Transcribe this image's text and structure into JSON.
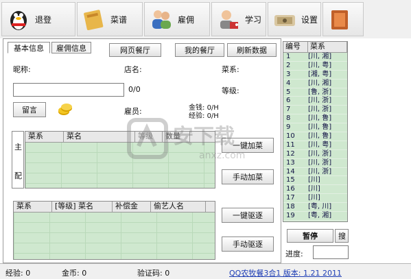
{
  "toolbar": {
    "buttons": [
      {
        "label": "退登",
        "icon": "penguin-icon"
      },
      {
        "label": "菜谱",
        "icon": "recipe-book-icon"
      },
      {
        "label": "雇佣",
        "icon": "people-icon"
      },
      {
        "label": "学习",
        "icon": "learning-icon"
      },
      {
        "label": "设置",
        "icon": "settings-icon"
      },
      {
        "label": "",
        "icon": "book-icon"
      }
    ]
  },
  "tabs": {
    "basic": "基本信息",
    "hire": "雇佣信息"
  },
  "nav_buttons": {
    "web_restaurant": "网页餐厅",
    "my_restaurant": "我的餐厅",
    "refresh": "刷新数据"
  },
  "profile": {
    "nickname_label": "昵称:",
    "nickname_value": "",
    "char_count": "0/0",
    "shop_label": "店名:",
    "cuisine_label": "菜系:",
    "level_label": "等级:",
    "employee_label": "雇员:",
    "money_label": "金钱:",
    "money_value": "0/H",
    "exp_label": "经验:",
    "exp_value": "0/H",
    "message_button": "留言",
    "coin_icon": "coins-icon"
  },
  "dish_grid": {
    "side_labels": [
      "主",
      "配"
    ],
    "columns": [
      "菜系",
      "菜名",
      "等级",
      "数量"
    ]
  },
  "helper_grid": {
    "columns": [
      "菜系",
      "[等级] 菜名",
      "补偿金",
      "偷艺人名"
    ]
  },
  "action_buttons": {
    "auto_add": "一键加菜",
    "manual_add": "手动加菜",
    "auto_kick": "一键驱逐",
    "manual_kick": "手动驱逐"
  },
  "cuisine_list": {
    "columns": [
      "编号",
      "菜系"
    ],
    "rows": [
      {
        "id": "1",
        "cuisine": "[川, 湘]"
      },
      {
        "id": "2",
        "cuisine": "[川, 粤]"
      },
      {
        "id": "3",
        "cuisine": "[湘, 粤]"
      },
      {
        "id": "4",
        "cuisine": "[川, 湘]"
      },
      {
        "id": "5",
        "cuisine": "[鲁, 浙]"
      },
      {
        "id": "6",
        "cuisine": "[川, 浙]"
      },
      {
        "id": "7",
        "cuisine": "[川, 浙]"
      },
      {
        "id": "8",
        "cuisine": "[川, 鲁]"
      },
      {
        "id": "9",
        "cuisine": "[川, 鲁]"
      },
      {
        "id": "10",
        "cuisine": "[川, 鲁]"
      },
      {
        "id": "11",
        "cuisine": "[川, 粤]"
      },
      {
        "id": "12",
        "cuisine": "[川, 浙]"
      },
      {
        "id": "13",
        "cuisine": "[川, 浙]"
      },
      {
        "id": "14",
        "cuisine": "[川, 浙]"
      },
      {
        "id": "15",
        "cuisine": "[川]"
      },
      {
        "id": "16",
        "cuisine": "[川]"
      },
      {
        "id": "17",
        "cuisine": "[川]"
      },
      {
        "id": "18",
        "cuisine": "[粤, 川]"
      },
      {
        "id": "19",
        "cuisine": "[粤, 湘]"
      }
    ]
  },
  "controls": {
    "pause": "暂停",
    "search_partial": "搜",
    "progress_label": "进度:"
  },
  "status": {
    "exp": "经验: 0",
    "coins": "金币: 0",
    "captcha": "验证码: 0",
    "version_link": "QQ农牧餐3合1 版本: 1.21 2011"
  },
  "watermark": {
    "text": "安下载",
    "url_text": "anxz.com"
  }
}
